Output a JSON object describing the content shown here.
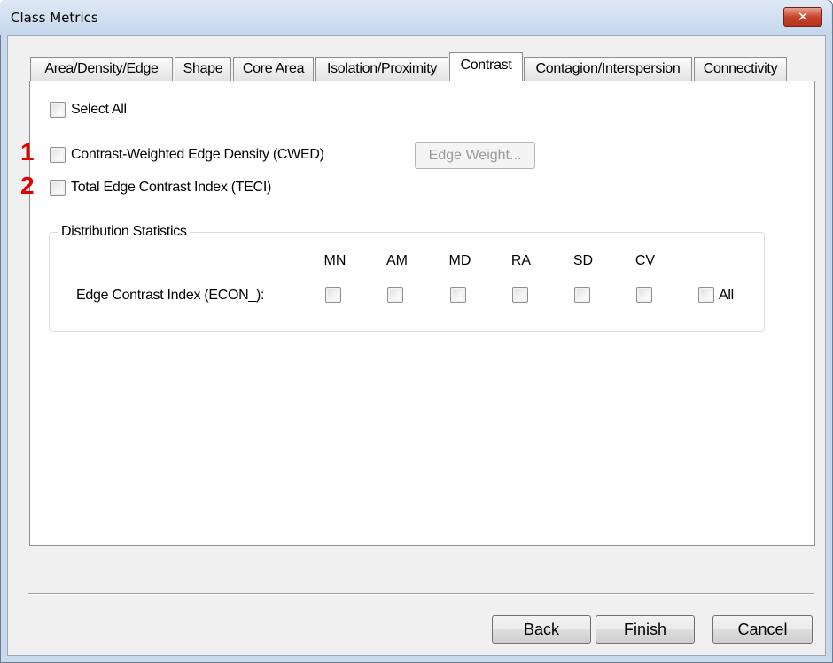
{
  "window": {
    "title": "Class Metrics",
    "close_glyph": "✕"
  },
  "tabs": [
    {
      "label": "Area/Density/Edge",
      "active": false
    },
    {
      "label": "Shape",
      "active": false
    },
    {
      "label": "Core Area",
      "active": false
    },
    {
      "label": "Isolation/Proximity",
      "active": false
    },
    {
      "label": "Contrast",
      "active": true
    },
    {
      "label": "Contagion/Interspersion",
      "active": false
    },
    {
      "label": "Connectivity",
      "active": false
    }
  ],
  "panel": {
    "select_all_label": "Select All",
    "metrics": [
      {
        "marker": "1",
        "label": "Contrast-Weighted Edge Density (CWED)",
        "checked": false
      },
      {
        "marker": "2",
        "label": "Total Edge Contrast Index (TECI)",
        "checked": false
      }
    ],
    "edge_weight_button": "Edge Weight...",
    "distribution": {
      "title": "Distribution Statistics",
      "columns": [
        "MN",
        "AM",
        "MD",
        "RA",
        "SD",
        "CV"
      ],
      "row_label": "Edge Contrast Index (ECON_):",
      "all_label": "All"
    }
  },
  "footer": {
    "back": "Back",
    "finish": "Finish",
    "cancel": "Cancel"
  },
  "colors": {
    "annotation": "#e00000",
    "title_bar": "#c4d6ec",
    "close_button": "#c8452d"
  }
}
